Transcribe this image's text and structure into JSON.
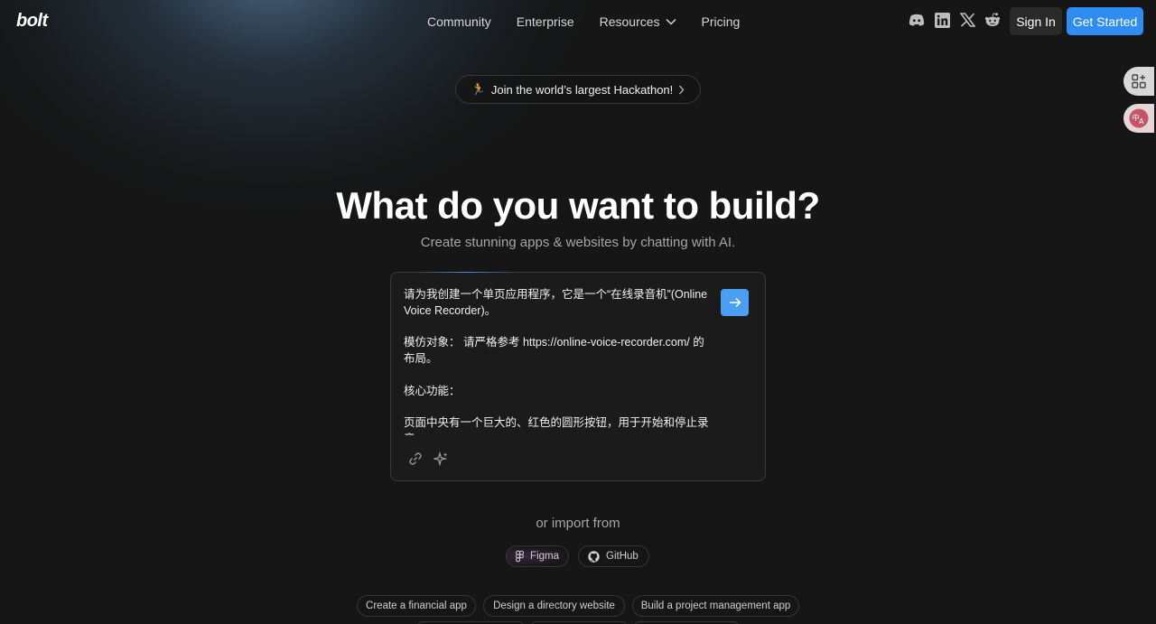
{
  "header": {
    "logo": "bolt",
    "nav": [
      "Community",
      "Enterprise",
      "Resources",
      "Pricing"
    ],
    "social_icons": [
      "discord-icon",
      "linkedin-icon",
      "x-icon",
      "reddit-icon"
    ],
    "sign_in": "Sign In",
    "get_started": "Get Started"
  },
  "banner": {
    "emoji": "🏃",
    "text": "Join the world’s largest Hackathon!"
  },
  "hero": {
    "title": "What do you want to build?",
    "subtitle": "Create stunning apps & websites by chatting with AI."
  },
  "prompt": {
    "text": "请为我创建一个单页应用程序，它是一个“在线录音机”(Online Voice Recorder)。\n\n模仿对象： 请严格参考 https://online-voice-recorder.com/ 的布局。\n\n核心功能：\n\n页面中央有一个巨大的、红色的圆形按钮，用于开始和停止录音。"
  },
  "import": {
    "title": "or import from",
    "figma": "Figma",
    "github": "GitHub"
  },
  "suggestions": [
    "Create a financial app",
    "Design a directory website",
    "Build a project management app"
  ],
  "colors": {
    "background": "#161616",
    "accent": "#2f8cf2",
    "send_button": "#4a9ff2"
  }
}
